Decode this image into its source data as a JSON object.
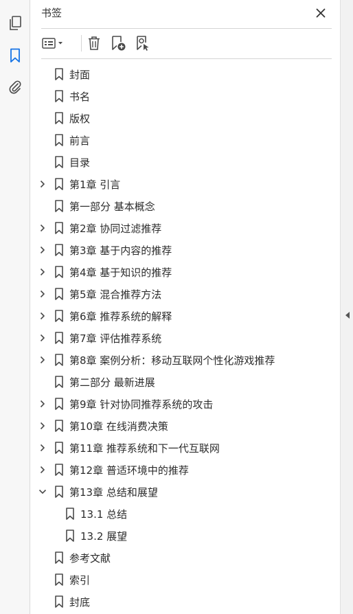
{
  "panel": {
    "title": "书签"
  },
  "bookmarks": [
    {
      "label": "封面",
      "level": 0,
      "state": "none"
    },
    {
      "label": "书名",
      "level": 0,
      "state": "none"
    },
    {
      "label": "版权",
      "level": 0,
      "state": "none"
    },
    {
      "label": "前言",
      "level": 0,
      "state": "none"
    },
    {
      "label": "目录",
      "level": 0,
      "state": "none"
    },
    {
      "label": "第1章 引言",
      "level": 0,
      "state": "collapsed"
    },
    {
      "label": "第一部分 基本概念",
      "level": 0,
      "state": "none"
    },
    {
      "label": "第2章 协同过滤推荐",
      "level": 0,
      "state": "collapsed"
    },
    {
      "label": "第3章 基于内容的推荐",
      "level": 0,
      "state": "collapsed"
    },
    {
      "label": "第4章 基于知识的推荐",
      "level": 0,
      "state": "collapsed"
    },
    {
      "label": "第5章 混合推荐方法",
      "level": 0,
      "state": "collapsed"
    },
    {
      "label": "第6章 推荐系统的解释",
      "level": 0,
      "state": "collapsed"
    },
    {
      "label": "第7章 评估推荐系统",
      "level": 0,
      "state": "collapsed"
    },
    {
      "label": "第8章 案例分析：移动互联网个性化游戏推荐",
      "level": 0,
      "state": "collapsed"
    },
    {
      "label": "第二部分 最新进展",
      "level": 0,
      "state": "none"
    },
    {
      "label": "第9章 针对协同推荐系统的攻击",
      "level": 0,
      "state": "collapsed"
    },
    {
      "label": "第10章 在线消费决策",
      "level": 0,
      "state": "collapsed"
    },
    {
      "label": "第11章 推荐系统和下一代互联网",
      "level": 0,
      "state": "collapsed"
    },
    {
      "label": "第12章 普适环境中的推荐",
      "level": 0,
      "state": "collapsed"
    },
    {
      "label": "第13章 总结和展望",
      "level": 0,
      "state": "expanded"
    },
    {
      "label": "13.1 总结",
      "level": 1,
      "state": "none"
    },
    {
      "label": "13.2 展望",
      "level": 1,
      "state": "none"
    },
    {
      "label": "参考文献",
      "level": 0,
      "state": "none"
    },
    {
      "label": "索引",
      "level": 0,
      "state": "none"
    },
    {
      "label": "封底",
      "level": 0,
      "state": "none"
    }
  ],
  "colors": {
    "accent": "#1473e6",
    "icon": "#4b4b4b",
    "text": "#2c2c2c"
  }
}
